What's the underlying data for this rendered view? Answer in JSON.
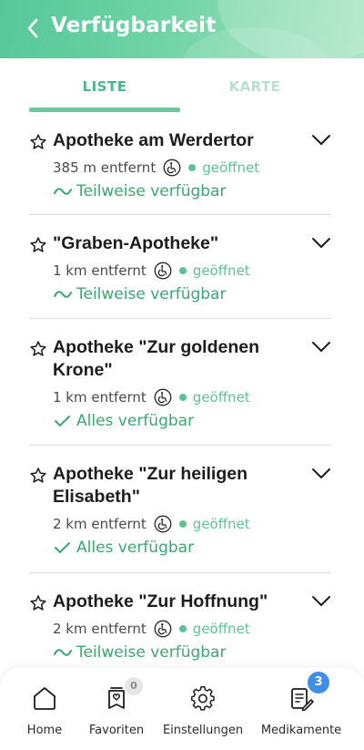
{
  "header": {
    "title": "Verfügbarkeit",
    "back_icon": "chevron-left-icon"
  },
  "tabs": [
    {
      "label": "LISTE",
      "active": true
    },
    {
      "label": "KARTE",
      "active": false
    }
  ],
  "colors": {
    "accent": "#5cc295",
    "header_start": "#56c79a",
    "header_end": "#a9e4c4",
    "badge_blue": "#3f8fe8"
  },
  "pharmacies": [
    {
      "name": "Apotheke am Werdertor",
      "distance": "385 m entfernt",
      "status": "geöffnet",
      "availability": "Teilweise verfügbar",
      "availability_icon": "tilde-icon"
    },
    {
      "name": "\"Graben-Apotheke\"",
      "distance": "1 km entfernt",
      "status": "geöffnet",
      "availability": "Teilweise verfügbar",
      "availability_icon": "tilde-icon"
    },
    {
      "name": "Apotheke \"Zur goldenen Krone\"",
      "distance": "1 km entfernt",
      "status": "geöffnet",
      "availability": "Alles verfügbar",
      "availability_icon": "check-icon"
    },
    {
      "name": "Apotheke \"Zur heiligen Elisabeth\"",
      "distance": "2 km entfernt",
      "status": "geöffnet",
      "availability": "Alles verfügbar",
      "availability_icon": "check-icon"
    },
    {
      "name": "Apotheke \"Zur Hoffnung\"",
      "distance": "2 km entfernt",
      "status": "geöffnet",
      "availability": "Teilweise verfügbar",
      "availability_icon": "tilde-icon"
    }
  ],
  "bottom_nav": [
    {
      "label": "Home",
      "icon": "home-icon"
    },
    {
      "label": "Favoriten",
      "icon": "favorites-icon",
      "badge": "0"
    },
    {
      "label": "Einstellungen",
      "icon": "gear-icon"
    },
    {
      "label": "Medikamente",
      "icon": "medication-list-icon",
      "badge": "3"
    }
  ]
}
